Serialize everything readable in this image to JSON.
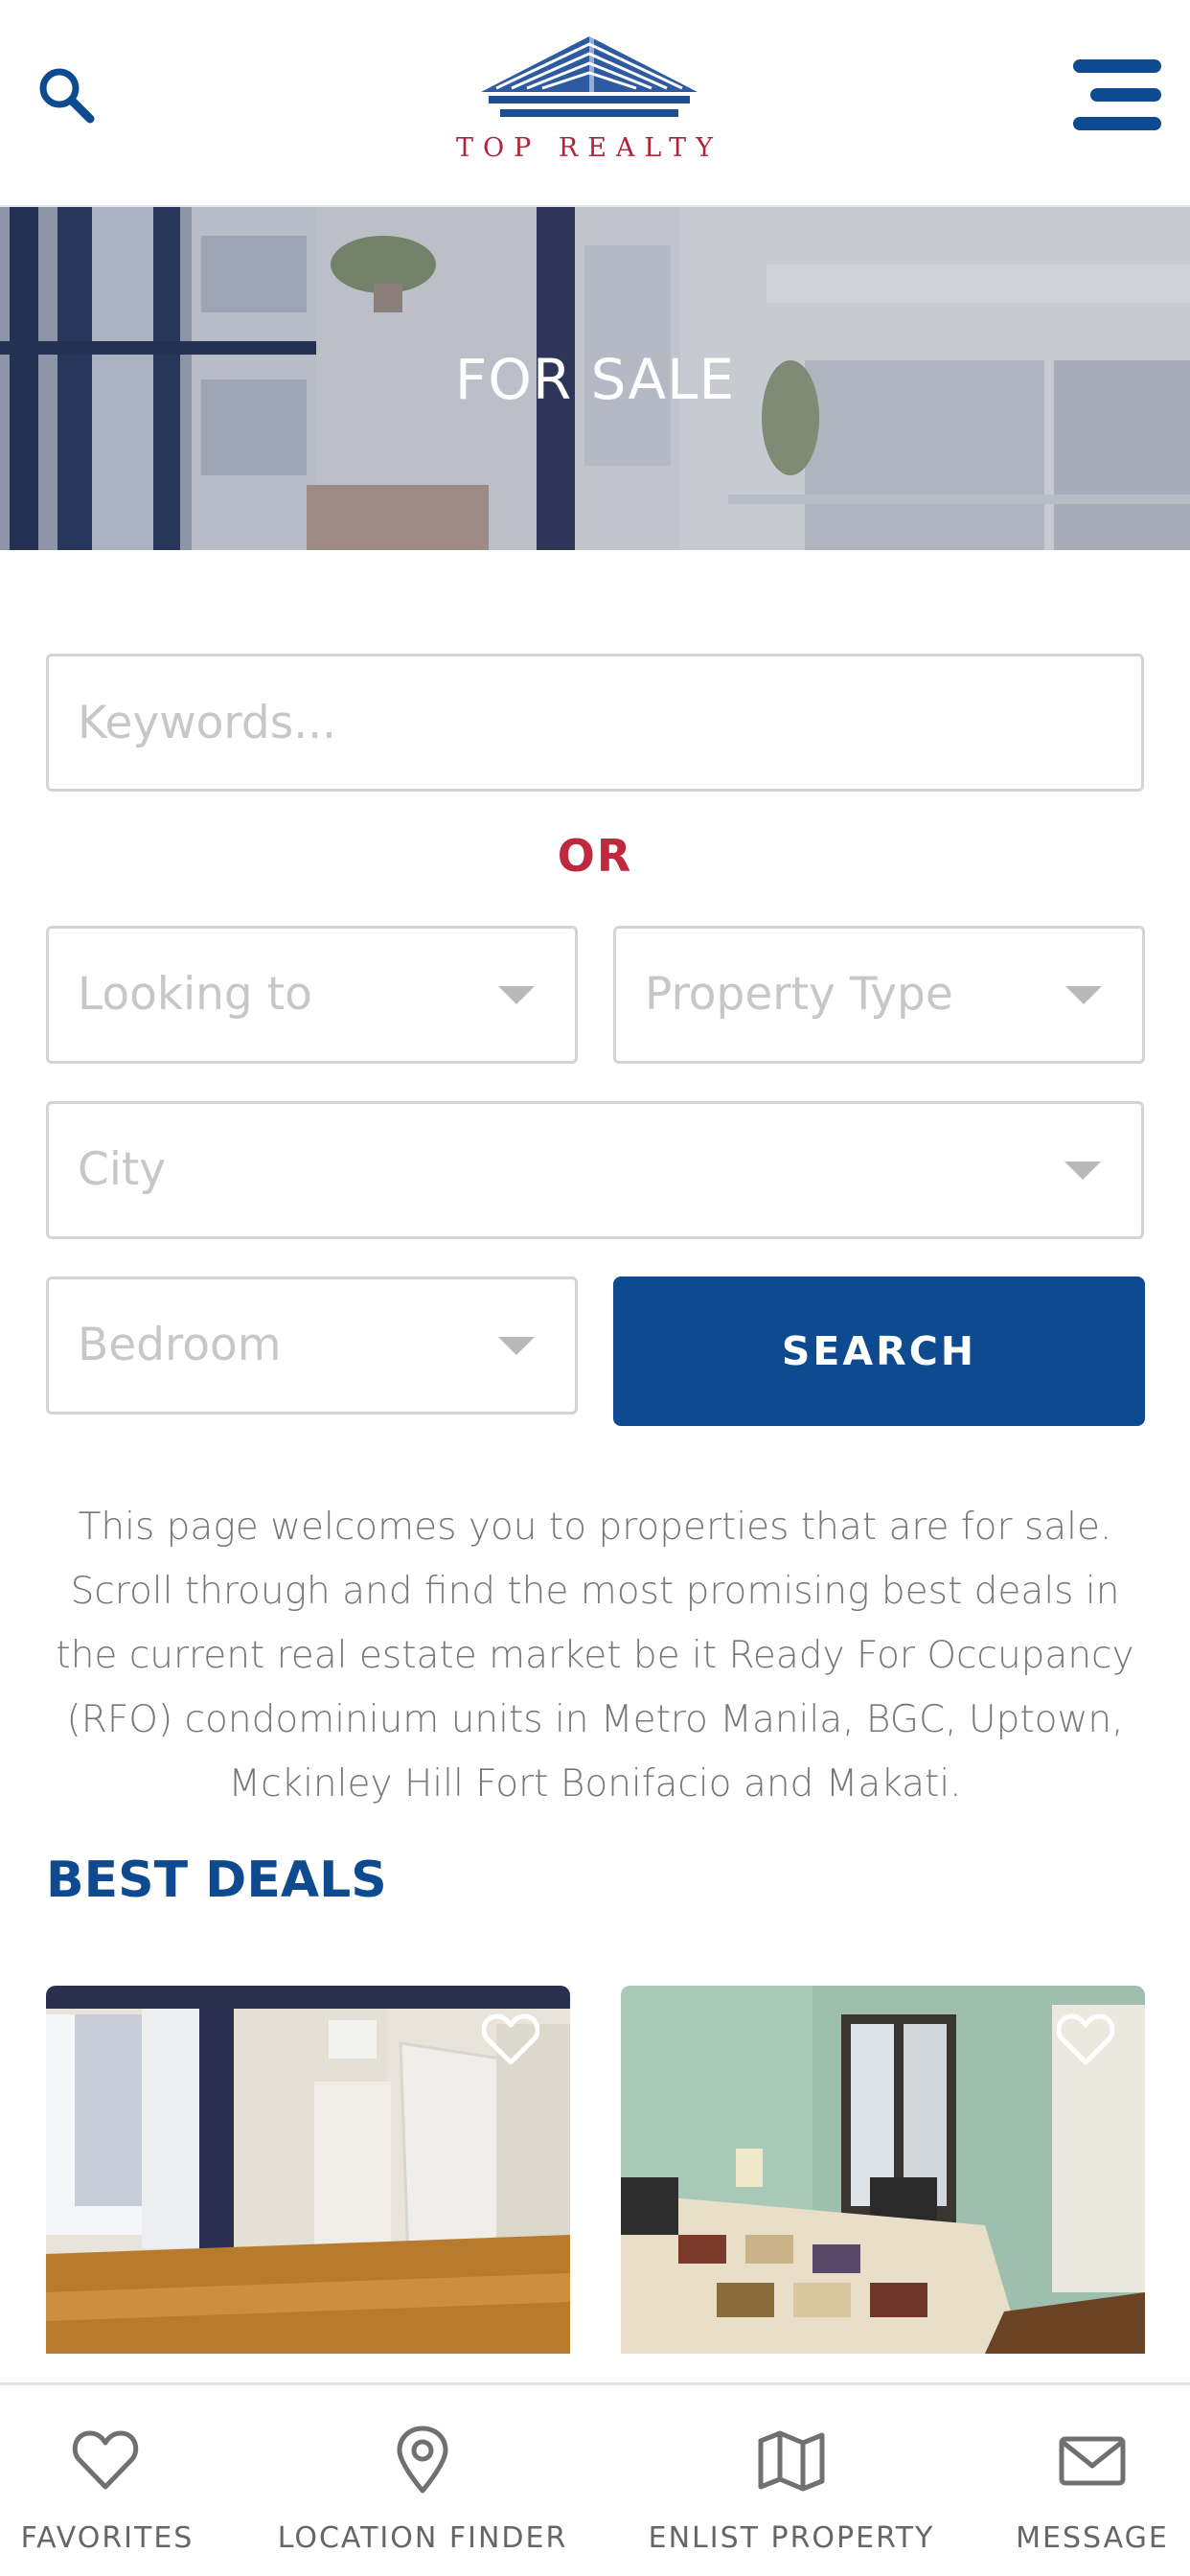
{
  "header": {
    "logo_text": "TOP REALTY",
    "search_icon": "search-icon",
    "menu_icon": "hamburger-menu-icon"
  },
  "hero": {
    "title": "FOR SALE"
  },
  "search_form": {
    "keywords_placeholder": "Keywords...",
    "or_label": "OR",
    "looking_to": "Looking to",
    "property_type": "Property Type",
    "city": "City",
    "bedroom": "Bedroom",
    "search_label": "SEARCH"
  },
  "intro_text": "This page welcomes you to properties that are for sale. Scroll through and find the most promising best deals in the current real estate market be it Ready For Occupancy (RFO) condominium units in Metro Manila, BGC, Uptown, Mckinley Hill Fort Bonifacio and Makati.",
  "best_deals": {
    "title": "BEST DEALS",
    "cards": [
      {
        "image": "empty-room-with-mattress",
        "fav_icon": "heart-icon"
      },
      {
        "image": "bedroom-with-bed-and-desk",
        "fav_icon": "heart-icon"
      }
    ]
  },
  "bottom_nav": {
    "items": [
      {
        "label": "FAVORITES",
        "icon": "heart-icon"
      },
      {
        "label": "LOCATION FINDER",
        "icon": "map-pin-icon"
      },
      {
        "label": "ENLIST PROPERTY",
        "icon": "map-icon"
      },
      {
        "label": "MESSAGE",
        "icon": "envelope-icon"
      }
    ]
  },
  "colors": {
    "brand_blue": "#0e4a8f",
    "accent_red": "#c0283e",
    "placeholder_grey": "#c7c7c7",
    "text_grey": "#777777"
  }
}
